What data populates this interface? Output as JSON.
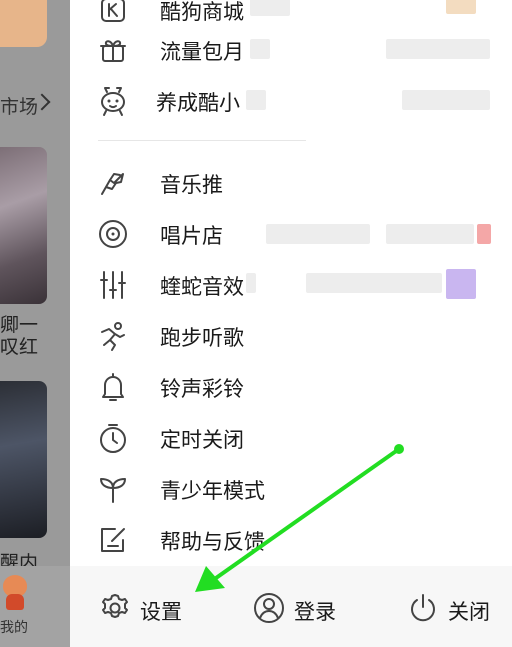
{
  "background": {
    "market_label": "市场",
    "card1_caption_line1": "卿一",
    "card1_caption_line2": "叹红",
    "card2_caption": "醒内",
    "mine_label": "我的"
  },
  "menu": {
    "items": [
      {
        "label": "酷狗商城",
        "icon": "k-store-icon"
      },
      {
        "label": "流量包月",
        "icon": "gift-icon"
      },
      {
        "label": "养成酷小",
        "icon": "pet-icon"
      },
      {
        "label": "音乐推",
        "icon": "music-promote-icon"
      },
      {
        "label": "唱片店",
        "icon": "vinyl-record-icon"
      },
      {
        "label": "蝰蛇音效",
        "icon": "equalizer-icon"
      },
      {
        "label": "跑步听歌",
        "icon": "running-icon"
      },
      {
        "label": "铃声彩铃",
        "icon": "bell-icon"
      },
      {
        "label": "定时关闭",
        "icon": "timer-icon"
      },
      {
        "label": "青少年模式",
        "icon": "sprout-icon"
      },
      {
        "label": "帮助与反馈",
        "icon": "help-feedback-icon"
      }
    ]
  },
  "footer": {
    "settings_label": "设置",
    "login_label": "登录",
    "close_label": "关闭"
  },
  "overlay": {
    "arrow_color": "#22dd22"
  }
}
